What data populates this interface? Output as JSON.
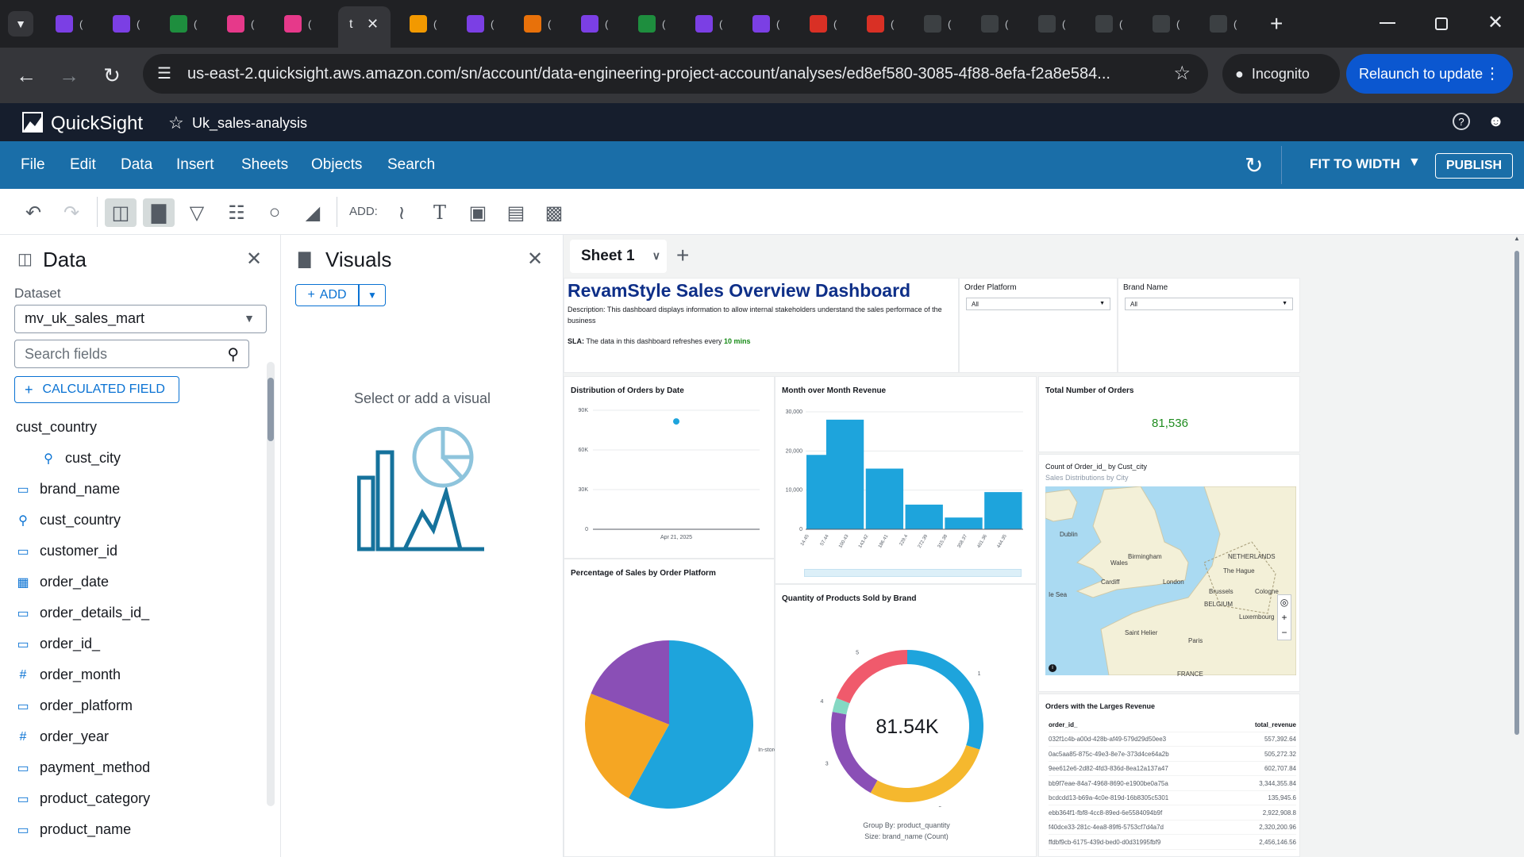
{
  "browser": {
    "url": "us-east-2.quicksight.aws.amazon.com/sn/account/data-engineering-project-account/analyses/ed8ef580-3085-4f88-8efa-f2a8e584...",
    "incognito_label": "Incognito",
    "relaunch_label": "Relaunch to update",
    "tab_letter": "t",
    "tab_mark": "("
  },
  "app": {
    "name": "QuickSight",
    "analysis_name": "Uk_sales-analysis",
    "fit_label": "FIT TO WIDTH",
    "publish_label": "PUBLISH"
  },
  "menu": [
    "File",
    "Edit",
    "Data",
    "Insert",
    "Sheets",
    "Objects",
    "Search"
  ],
  "toolbar": {
    "add_label": "ADD:"
  },
  "data_panel": {
    "title": "Data",
    "dataset_label": "Dataset",
    "dataset_value": "mv_uk_sales_mart",
    "search_placeholder": "Search fields",
    "calc_field_label": "CALCULATED FIELD",
    "hierarchy_name": "cust_country",
    "hierarchy_child": "cust_city",
    "fields": [
      {
        "name": "brand_name",
        "icon": "string-icon"
      },
      {
        "name": "cust_country",
        "icon": "geo-icon"
      },
      {
        "name": "customer_id",
        "icon": "string-icon"
      },
      {
        "name": "order_date",
        "icon": "date-icon"
      },
      {
        "name": "order_details_id_",
        "icon": "string-icon"
      },
      {
        "name": "order_id_",
        "icon": "string-icon"
      },
      {
        "name": "order_month",
        "icon": "number-icon"
      },
      {
        "name": "order_platform",
        "icon": "string-icon"
      },
      {
        "name": "order_year",
        "icon": "number-icon"
      },
      {
        "name": "payment_method",
        "icon": "string-icon"
      },
      {
        "name": "product_category",
        "icon": "string-icon"
      },
      {
        "name": "product_name",
        "icon": "string-icon"
      }
    ]
  },
  "visuals_panel": {
    "title": "Visuals",
    "add_label": "ADD",
    "empty_text": "Select or add a visual"
  },
  "sheet": {
    "tab_label": "Sheet 1"
  },
  "dashboard": {
    "title": "RevamStyle Sales Overview Dashboard",
    "description": "Description: This dashboard displays information to allow internal stakeholders understand the sales performace of the business",
    "sla_prefix": "SLA:",
    "sla_text": "The data in this dashboard refreshes every",
    "sla_value": "10 mins",
    "filters": [
      {
        "label": "Order Platform",
        "value": "All"
      },
      {
        "label": "Brand Name",
        "value": "All"
      }
    ],
    "kpi": {
      "title": "Total Number of Orders",
      "value": "81,536"
    },
    "map": {
      "title": "Count of Order_id_ by Cust_city",
      "subtitle": "Sales Distributions by City",
      "labels": [
        "Dublin",
        "Birmingham",
        "Cardiff",
        "London",
        "Wales",
        "NETHERLANDS",
        "The Hague",
        "Brussels",
        "BELGIUM",
        "Cologne",
        "Luxembourg",
        "Saint Helier",
        "Paris",
        "FRANCE",
        "Ie Sea"
      ]
    },
    "table": {
      "title": "Orders with the Larges Revenue",
      "headers": [
        "order_id_",
        "total_revenue"
      ],
      "rows": [
        [
          "032f1c4b-a00d-428b-af49-579d29d50ee3",
          "557,392.64"
        ],
        [
          "0ac5aa85-875c-49e3-8e7e-373d4ce64a2b",
          "505,272.32"
        ],
        [
          "9ee612e6-2d82-4fd3-836d-8ea12a137a47",
          "602,707.84"
        ],
        [
          "bb9f7eae-84a7-4968-8690-e1900be0a75a",
          "3,344,355.84"
        ],
        [
          "bcdcdd13-b69a-4c0e-819d-16b8305c5301",
          "135,945.6"
        ],
        [
          "ebb364f1-fbf8-4cc8-89ed-6e5584094b9f",
          "2,922,908.8"
        ],
        [
          "f40dce33-281c-4ea8-89f6-5753cf7d4a7d",
          "2,320,200.96"
        ],
        [
          "ffdbf9cb-6175-439d-bed0-d0d31995fbf9",
          "2,456,146.56"
        ]
      ]
    }
  },
  "chart_data": [
    {
      "type": "scatter",
      "title": "Distribution of Orders by Date",
      "x": [
        "Apr 21, 2025"
      ],
      "y": [
        81536
      ],
      "yticks": [
        "90K",
        "60K",
        "30K",
        "0"
      ],
      "ylim": [
        0,
        90000
      ],
      "color": "#1ea4dc"
    },
    {
      "type": "bar",
      "title": "Month over Month Revenue",
      "categories": [
        "14.45",
        "57.44",
        "100.43",
        "143.42",
        "186.41",
        "229.4",
        "272.39",
        "315.38",
        "358.37",
        "401.36",
        "444.35"
      ],
      "values": [
        19000,
        28000,
        0,
        15500,
        0,
        6300,
        0,
        3000,
        0,
        9500,
        0
      ],
      "yticks": [
        "30,000",
        "20,000",
        "10,000",
        "0"
      ],
      "ylim": [
        0,
        30000
      ],
      "color": "#1ea4dc"
    },
    {
      "type": "pie",
      "title": "Percentage of Sales by Order Platform",
      "labels": [
        "In-store",
        "",
        ""
      ],
      "values": [
        58,
        23,
        19
      ],
      "colors": [
        "#1ea4dc",
        "#f5a623",
        "#8a4fb6"
      ]
    },
    {
      "type": "pie",
      "title": "Quantity of Products Sold by Brand",
      "center_label": "81.54K",
      "labels": [
        "1",
        "2",
        "3",
        "4",
        "5"
      ],
      "values": [
        30,
        28,
        20,
        3,
        19
      ],
      "colors": [
        "#1ea4dc",
        "#f5b82e",
        "#8a4fb6",
        "#84d8c3",
        "#f05a6c"
      ],
      "footer": [
        "Group By: product_quantity",
        "Size: brand_name (Count)"
      ]
    }
  ]
}
